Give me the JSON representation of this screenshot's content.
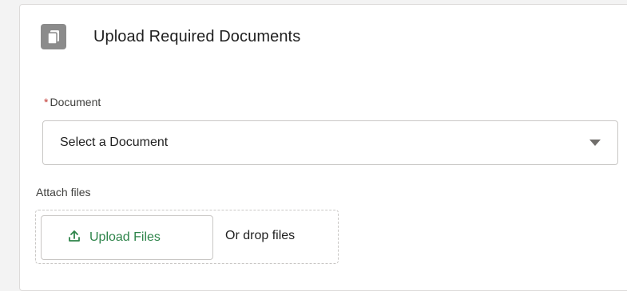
{
  "card": {
    "title": "Upload Required Documents",
    "icon": "document-icon"
  },
  "document_field": {
    "required_marker": "*",
    "label": "Document",
    "selected_value": "Select a Document",
    "arrow_icon": "chevron-down-icon"
  },
  "attach_files": {
    "label": "Attach files",
    "upload_button_label": "Upload Files",
    "upload_icon": "upload-icon",
    "drop_text": "Or drop files"
  },
  "colors": {
    "accent_green": "#2e844a",
    "required_red": "#c23934",
    "icon_gray": "#8b8b8b"
  }
}
